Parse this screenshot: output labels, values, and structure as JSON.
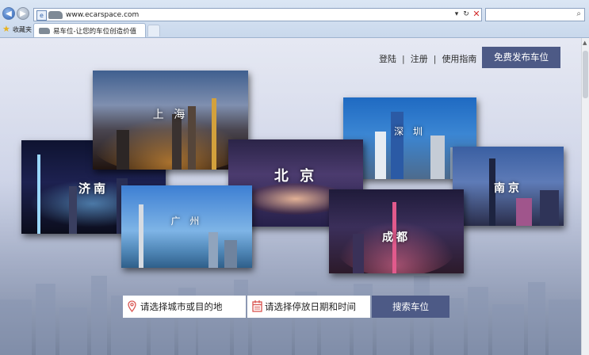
{
  "browser": {
    "url": "www.ecarspace.com",
    "tab_title": "易车位-让您的车位创造价值",
    "favorites_label": "收藏夹",
    "back_glyph": "◀",
    "forward_glyph": "▶",
    "refresh_glyph": "↻",
    "dropdown_glyph": "▾",
    "stop_glyph": "✕",
    "search_glyph": "⌕",
    "star_glyph": "★",
    "compat_glyph": "e"
  },
  "header": {
    "links": [
      "登陆",
      "注册",
      "使用指南"
    ],
    "separator": "|",
    "publish_button": "免费发布车位"
  },
  "cities": {
    "shanghai": "上 海",
    "shenzhen": "深 圳",
    "jinan": "济南",
    "beijing": "北 京",
    "nanjing": "南京",
    "guangzhou": "广 州",
    "chengdu": "成都"
  },
  "search": {
    "city_placeholder": "请选择城市或目的地",
    "date_placeholder": "请选择停放日期和时间",
    "button": "搜索车位"
  },
  "colors": {
    "accent": "#4d5a86",
    "pin": "#d9534f"
  },
  "icons": [
    "back-icon",
    "forward-icon",
    "refresh-icon",
    "stop-icon",
    "search-icon",
    "star-icon",
    "map-pin-icon",
    "calendar-icon"
  ]
}
